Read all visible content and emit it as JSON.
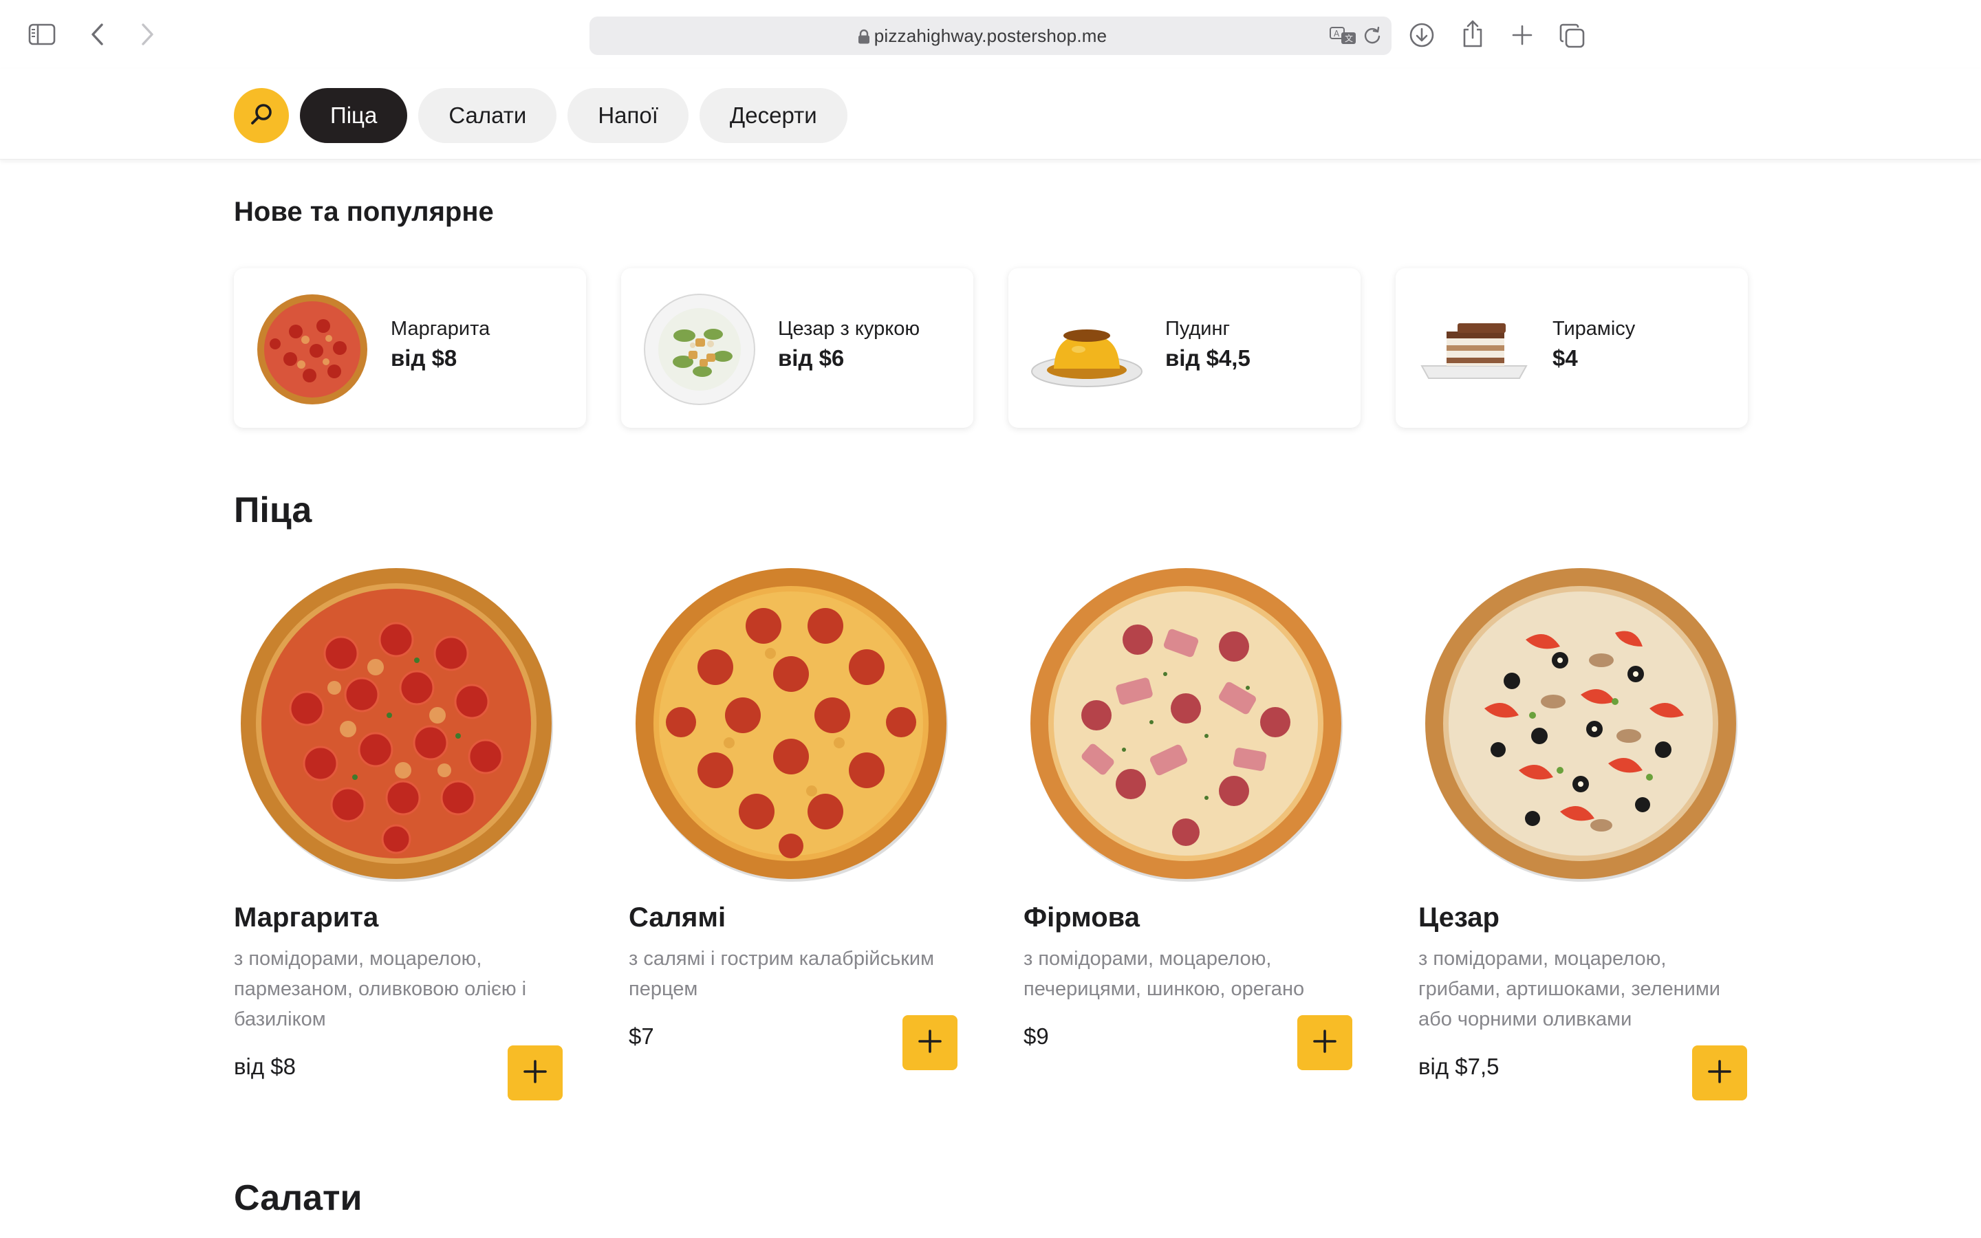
{
  "browser": {
    "url": "pizzahighway.postershop.me"
  },
  "nav": {
    "search_icon": "search-icon",
    "categories": [
      {
        "label": "Піца",
        "active": true
      },
      {
        "label": "Салати",
        "active": false
      },
      {
        "label": "Напої",
        "active": false
      },
      {
        "label": "Десерти",
        "active": false
      }
    ]
  },
  "popular": {
    "title": "Нове та популярне",
    "items": [
      {
        "name": "Маргарита",
        "price": "від $8"
      },
      {
        "name": "Цезар з куркою",
        "price": "від $6"
      },
      {
        "name": "Пудинг",
        "price": "від $4,5"
      },
      {
        "name": "Тирамісу",
        "price": "$4"
      }
    ]
  },
  "pizza": {
    "title": "Піца",
    "items": [
      {
        "name": "Маргарита",
        "description": "з помідорами, моцарелою, пармезаном, оливковою олією і базиліком",
        "price": "від $8"
      },
      {
        "name": "Салямі",
        "description": "з салямі і гострим калабрійським перцем",
        "price": "$7"
      },
      {
        "name": "Фірмова",
        "description": "з помідорами, моцарелою, печерицями, шинкою, орегано",
        "price": "$9"
      },
      {
        "name": "Цезар",
        "description": "з помідорами, моцарелою, грибами, артишоками, зеленими або чорними оливками",
        "price": "від $7,5"
      }
    ]
  },
  "salads": {
    "title": "Салати"
  },
  "colors": {
    "accent": "#f8bc26",
    "active_pill": "#231f20",
    "pill_bg": "#f0f0f0",
    "muted_text": "#86868b"
  }
}
